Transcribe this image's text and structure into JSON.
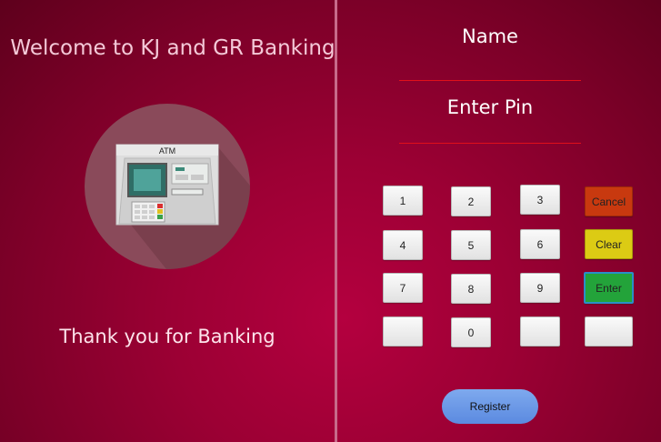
{
  "left": {
    "welcome_title": "Welcome to KJ and GR Banking",
    "atm_sign": "ATM",
    "thank_you": "Thank you for Banking"
  },
  "right": {
    "name_label": "Name",
    "pin_label": "Enter Pin",
    "keys": [
      "1",
      "2",
      "3",
      "4",
      "5",
      "6",
      "7",
      "8",
      "9",
      "",
      "0",
      ""
    ],
    "cancel_label": "Cancel",
    "clear_label": "Clear",
    "enter_label": "Enter",
    "register_label": "Register"
  },
  "colors": {
    "background": "#9c0034",
    "cancel": "#c8390f",
    "clear": "#dccb14",
    "enter": "#23a33a",
    "register": "#6b97e8"
  }
}
